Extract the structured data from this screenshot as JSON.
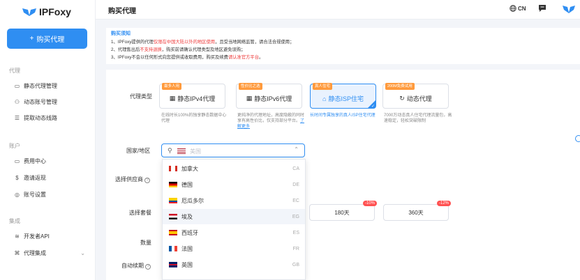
{
  "app": {
    "brand": "IPFoxy"
  },
  "sidebar": {
    "buy_button": "购买代理",
    "sections": [
      {
        "title": "代理",
        "items": [
          "静态代理管理",
          "动态账号管理",
          "提取动态线路"
        ]
      },
      {
        "title": "账户",
        "items": [
          "费用中心",
          "邀请返现",
          "账号设置"
        ]
      },
      {
        "title": "集成",
        "items": [
          "开发者API",
          "代理集成"
        ]
      }
    ]
  },
  "header": {
    "title": "购买代理",
    "lang": "CN"
  },
  "notice": {
    "title": "购买须知",
    "lines": [
      {
        "pre": "1、IPFoxy提供的代理",
        "red": "仅限在中国大陆以外的地区使用",
        "post": "，且受当地网络监管，请合法合规使用；"
      },
      {
        "pre": "2、代理售出后",
        "red": "不支持退换",
        "post": "，购买前请确认代理类型及地区避免误购；"
      },
      {
        "pre": "3、IPFoxy不会以任何形式向您提供或收取费用，购买及续费",
        "red": "请认准官方平台",
        "post": "。"
      }
    ]
  },
  "form": {
    "proxy_type_label": "代理类型",
    "types": [
      {
        "tag": "最多人用",
        "name": "静态IPv4代理",
        "desc": "在线时长100%的独享静态数据中心代理",
        "link": ""
      },
      {
        "tag": "性价比之选",
        "name": "静态IPv6代理",
        "desc": "更纯净的代理地址，高度隐蔽的同时享有高性价比，仅支持部分平台。",
        "link": "了解更多"
      },
      {
        "tag": "真人住宅",
        "name": "静态ISP住宅",
        "desc": "长时间专属独享的真人ISP住宅代理",
        "link": ""
      },
      {
        "tag": "200M免费试用",
        "name": "动态代理",
        "desc": "7000万动态真人住宅代理流量包，高速稳定，轻松突破限制",
        "link": ""
      }
    ],
    "region_label": "国家/地区",
    "region_placeholder": "美国",
    "provider_label": "选择供应商",
    "plan_label": "选择套餐",
    "plans": [
      {
        "name": "180天",
        "discount": "-10%"
      },
      {
        "name": "360天",
        "discount": "-12%"
      }
    ],
    "quantity_label": "数量",
    "auto_renew_label": "自动续期"
  },
  "dropdown": [
    {
      "name": "加拿大",
      "code": "CA"
    },
    {
      "name": "德国",
      "code": "DE"
    },
    {
      "name": "厄瓜多尔",
      "code": "EC"
    },
    {
      "name": "埃及",
      "code": "EG"
    },
    {
      "name": "西班牙",
      "code": "ES"
    },
    {
      "name": "法国",
      "code": "FR"
    },
    {
      "name": "英国",
      "code": "GB"
    }
  ],
  "colors": {
    "accent": "#2f8ef2",
    "danger": "#ee3b3b",
    "tag": "#ff9a3c"
  }
}
